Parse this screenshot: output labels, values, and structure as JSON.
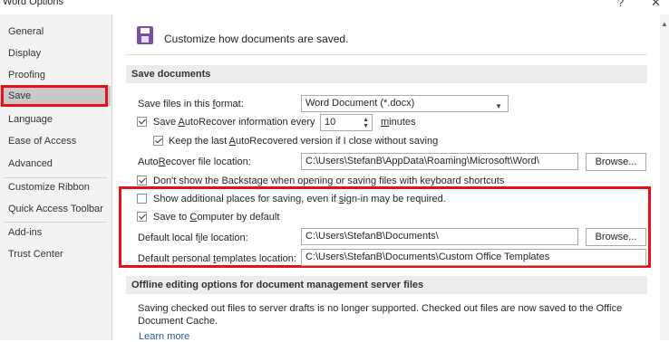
{
  "window": {
    "title": "Word Options",
    "help_label": "?",
    "close_label": "✕"
  },
  "sidebar": {
    "items": [
      {
        "label": "General"
      },
      {
        "label": "Display"
      },
      {
        "label": "Proofing"
      },
      {
        "label": "Save"
      },
      {
        "label": "Language"
      },
      {
        "label": "Ease of Access"
      },
      {
        "label": "Advanced"
      },
      {
        "label": "Customize Ribbon"
      },
      {
        "label": "Quick Access Toolbar"
      },
      {
        "label": "Add-ins"
      },
      {
        "label": "Trust Center"
      }
    ],
    "selected": "Save"
  },
  "header": {
    "icon": "save-disk-icon",
    "text": "Customize how documents are saved."
  },
  "save_documents": {
    "section_title": "Save documents",
    "format_label": "Save files in this format:",
    "format_value": "Word Document (*.docx)",
    "autorecover_label": "Save AutoRecover information every",
    "autorecover_checked": true,
    "autorecover_minutes": "10",
    "minutes_label": "minutes",
    "keep_last_label": "Keep the last AutoRecovered version if I close without saving",
    "keep_last_checked": true,
    "ar_location_label": "AutoRecover file location:",
    "ar_location_value": "C:\\Users\\StefanB\\AppData\\Roaming\\Microsoft\\Word\\",
    "browse_label": "Browse...",
    "backstage_label": "Don't show the Backstage when opening or saving files with keyboard shortcuts",
    "backstage_checked": true,
    "additional_places_label": "Show additional places for saving, even if sign-in may be required.",
    "additional_places_checked": false,
    "save_to_computer_label": "Save to Computer by default",
    "save_to_computer_checked": true,
    "default_local_label": "Default local file location:",
    "default_local_value": "C:\\Users\\StefanB\\Documents\\",
    "browse2_label": "Browse...",
    "templates_label": "Default personal templates location:",
    "templates_value": "C:\\Users\\StefanB\\Documents\\Custom Office Templates"
  },
  "offline": {
    "section_title": "Offline editing options for document management server files",
    "info_line1": "Saving checked out files to server drafts is no longer supported. Checked out files are now saved to the Office",
    "info_line2": "Document Cache.",
    "learn_more": "Learn more"
  },
  "colors": {
    "highlight_red": "#e3121b",
    "accent_purple": "#7b4fa0",
    "link_blue": "#2b579a"
  }
}
